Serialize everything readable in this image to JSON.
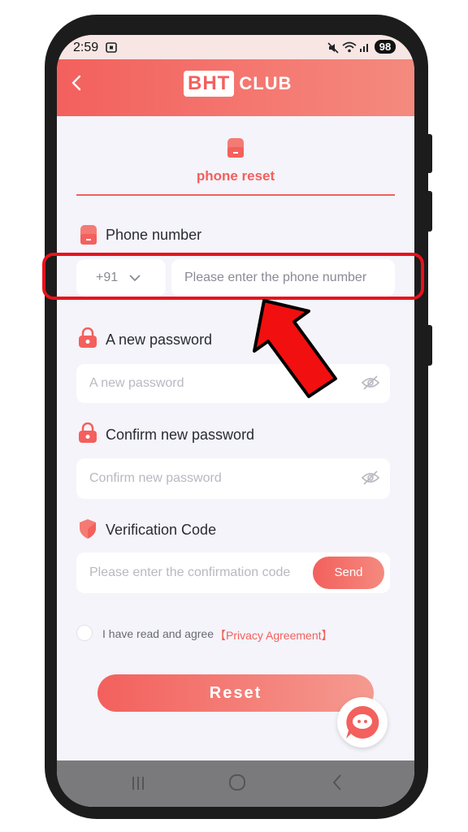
{
  "status_bar": {
    "time": "2:59",
    "battery": "98"
  },
  "header": {
    "logo_part1": "BHT",
    "logo_part2": "CLUB"
  },
  "tab": {
    "label": "phone reset"
  },
  "phone_field": {
    "label": "Phone number",
    "country_code": "+91",
    "placeholder": "Please enter the phone number"
  },
  "new_password": {
    "label": "A new password",
    "placeholder": "A new password"
  },
  "confirm_password": {
    "label": "Confirm new password",
    "placeholder": "Confirm new password"
  },
  "verification": {
    "label": "Verification Code",
    "placeholder": "Please enter the confirmation code",
    "send_label": "Send"
  },
  "agreement": {
    "text": "I have read and agree",
    "link": "【Privacy Agreement】"
  },
  "reset_label": "Reset",
  "colors": {
    "accent": "#f3605d",
    "highlight": "#e8121b"
  }
}
